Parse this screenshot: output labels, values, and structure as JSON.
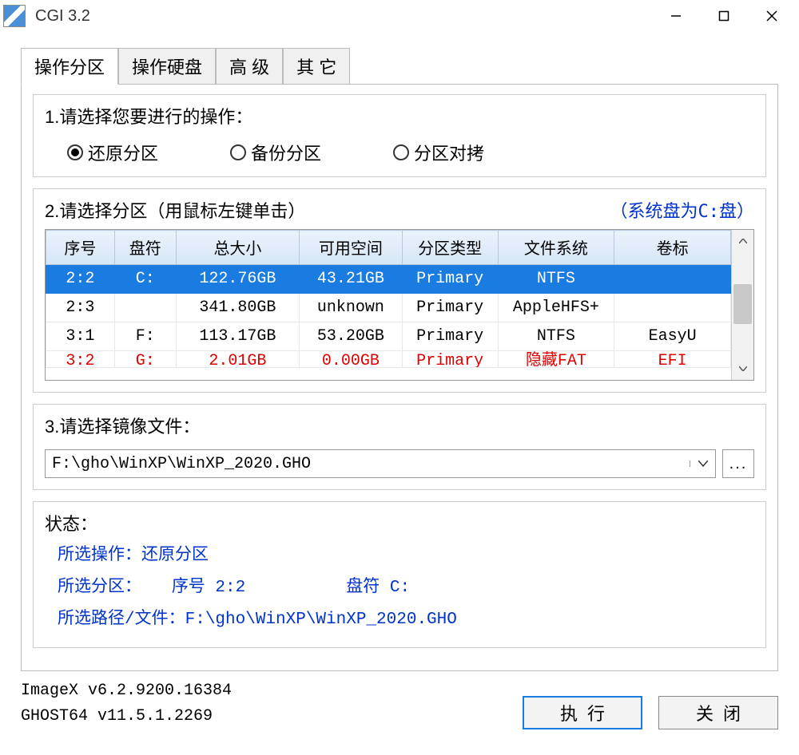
{
  "window": {
    "title": "CGI 3.2"
  },
  "tabs": [
    {
      "label": "操作分区",
      "active": true
    },
    {
      "label": "操作硬盘",
      "active": false
    },
    {
      "label": "高 级",
      "active": false
    },
    {
      "label": "其 它",
      "active": false
    }
  ],
  "section1": {
    "title": "1.请选择您要进行的操作：",
    "options": [
      {
        "label": "还原分区",
        "selected": true
      },
      {
        "label": "备份分区",
        "selected": false
      },
      {
        "label": "分区对拷",
        "selected": false
      }
    ]
  },
  "section2": {
    "title": "2.请选择分区（用鼠标左键单击）",
    "hint": "（系统盘为C:盘）",
    "columns": [
      "序号",
      "盘符",
      "总大小",
      "可用空间",
      "分区类型",
      "文件系统",
      "卷标"
    ],
    "rows": [
      {
        "cells": [
          "2:2",
          "C:",
          "122.76GB",
          "43.21GB",
          "Primary",
          "NTFS",
          ""
        ],
        "selected": true
      },
      {
        "cells": [
          "2:3",
          "",
          "341.80GB",
          "unknown",
          "Primary",
          "AppleHFS+",
          ""
        ],
        "selected": false
      },
      {
        "cells": [
          "3:1",
          "F:",
          "113.17GB",
          "53.20GB",
          "Primary",
          "NTFS",
          "EasyU"
        ],
        "selected": false
      },
      {
        "cells": [
          "3:2",
          "G:",
          "2.01GB",
          "0.00GB",
          "Primary",
          "隐藏FAT",
          "EFI"
        ],
        "selected": false,
        "red": true,
        "partial": true
      }
    ]
  },
  "section3": {
    "title": "3.请选择镜像文件：",
    "path": "F:\\gho\\WinXP\\WinXP_2020.GHO",
    "browse": "..."
  },
  "status": {
    "title": "状态：",
    "op_label": "所选操作：",
    "op_value": "还原分区",
    "part_label": "所选分区：",
    "part_idx_label": "序号",
    "part_idx_value": "2:2",
    "part_letter_label": "盘符",
    "part_letter_value": "C:",
    "path_label": "所选路径/文件：",
    "path_value": "F:\\gho\\WinXP\\WinXP_2020.GHO"
  },
  "footer": {
    "imagex_version": "ImageX v6.2.9200.16384",
    "ghost_version": "GHOST64 v11.5.1.2269",
    "execute": "执行",
    "close": "关闭"
  }
}
